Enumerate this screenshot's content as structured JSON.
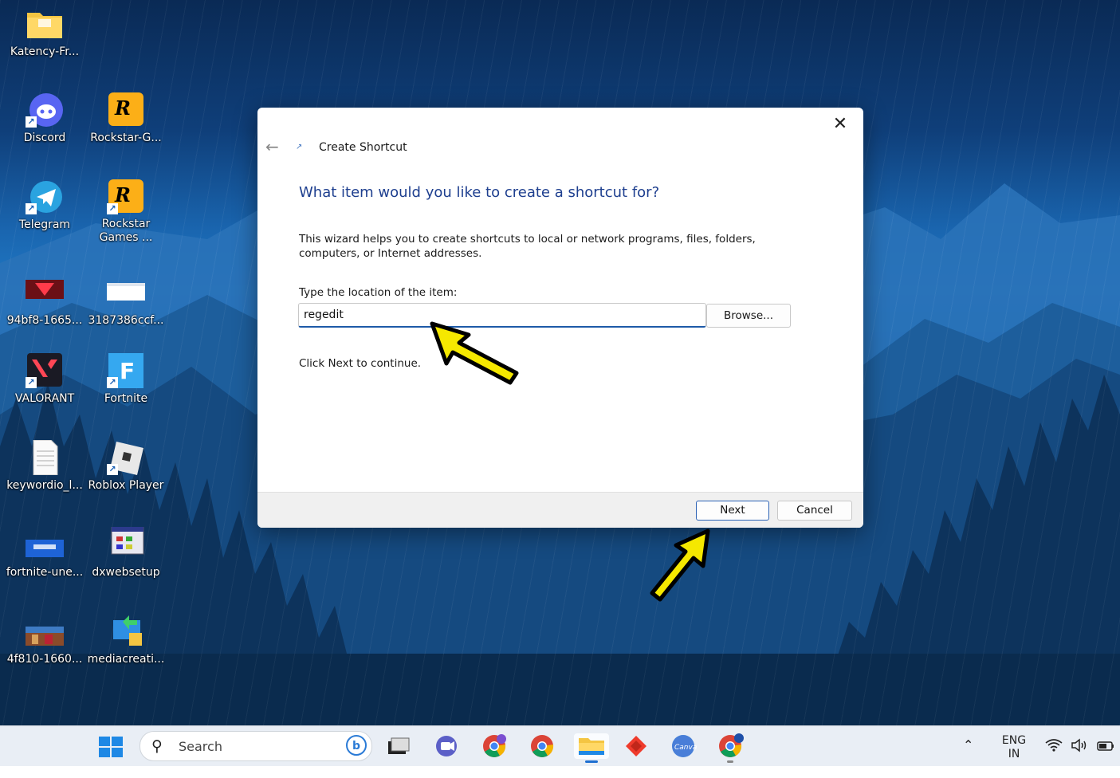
{
  "desktop": {
    "icons": [
      {
        "label": "Katency-Fr..."
      },
      {
        "label": "Discord"
      },
      {
        "label": "Rockstar-G..."
      },
      {
        "label": "Telegram"
      },
      {
        "label": "Rockstar Games ..."
      },
      {
        "label": "94bf8-1665..."
      },
      {
        "label": "3187386ccf..."
      },
      {
        "label": "VALORANT"
      },
      {
        "label": "Fortnite"
      },
      {
        "label": "keywordio_l..."
      },
      {
        "label": "Roblox Player"
      },
      {
        "label": "fortnite-une..."
      },
      {
        "label": "dxwebsetup"
      },
      {
        "label": "4f810-1660..."
      },
      {
        "label": "mediacreati..."
      }
    ]
  },
  "dialog": {
    "title": "Create Shortcut",
    "heading": "What item would you like to create a shortcut for?",
    "description": "This wizard helps you to create shortcuts to local or network programs, files, folders, computers, or Internet addresses.",
    "location_label": "Type the location of the item:",
    "location_value": "regedit",
    "browse_label": "Browse...",
    "hint": "Click Next to continue.",
    "next_label": "Next",
    "cancel_label": "Cancel"
  },
  "taskbar": {
    "search_placeholder": "Search",
    "language_top": "ENG",
    "language_bottom": "IN",
    "apps": [
      "file-explorer-icon",
      "teams-icon",
      "chrome-icon",
      "chrome-icon",
      "file-explorer-icon",
      "anydesk-icon",
      "canva-icon",
      "chrome-icon"
    ]
  },
  "colors": {
    "heading": "#1e3f8f",
    "accent": "#1e5aa8",
    "arrow_fill": "#f5e800"
  }
}
